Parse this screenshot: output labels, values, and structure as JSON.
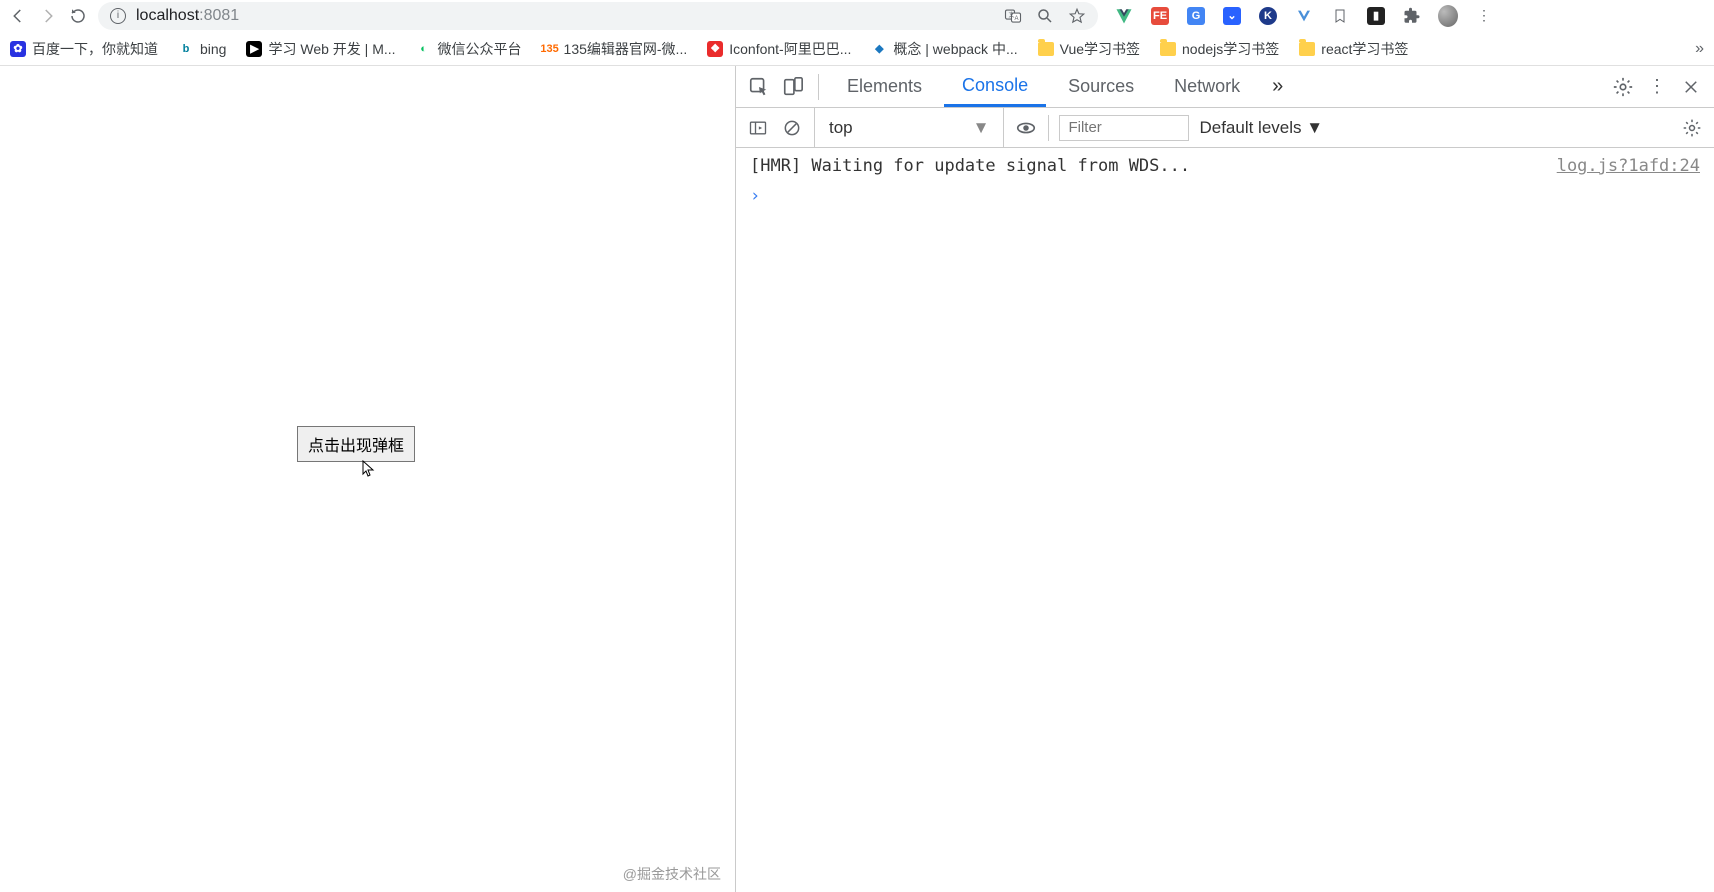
{
  "addr": {
    "url_host": "localhost",
    "url_port": ":8081"
  },
  "bookmarks": [
    {
      "label": "百度一下，你就知道",
      "icon_bg": "#2932e1",
      "icon_txt": "✿"
    },
    {
      "label": "bing",
      "icon_bg": "#ffffff",
      "icon_txt": "b",
      "icon_color": "#00809d"
    },
    {
      "label": "学习 Web 开发 | M...",
      "icon_bg": "#000",
      "icon_txt": "▶"
    },
    {
      "label": "微信公众平台",
      "icon_bg": "#fff",
      "icon_txt": "◐",
      "icon_color": "#07c160"
    },
    {
      "label": "135编辑器官网-微...",
      "icon_bg": "#fff",
      "icon_txt": "135",
      "icon_color": "#ff6a00"
    },
    {
      "label": "Iconfont-阿里巴巴...",
      "icon_bg": "#ea2b2b",
      "icon_txt": "❖"
    },
    {
      "label": "概念 | webpack 中...",
      "icon_bg": "#fff",
      "icon_txt": "◆",
      "icon_color": "#1c78c0"
    },
    {
      "label": "Vue学习书签",
      "folder": true
    },
    {
      "label": "nodejs学习书签",
      "folder": true
    },
    {
      "label": "react学习书签",
      "folder": true
    }
  ],
  "page": {
    "button_label": "点击出现弹框",
    "watermark": "@掘金技术社区"
  },
  "devtools": {
    "tabs": [
      "Elements",
      "Console",
      "Sources",
      "Network"
    ],
    "active_tab": 1,
    "more_glyph": "»",
    "context": "top",
    "filter_placeholder": "Filter",
    "levels_label": "Default levels ▼",
    "log_message": "[HMR] Waiting for update signal from WDS...",
    "log_source": "log.js?1afd:24",
    "prompt": "›"
  }
}
